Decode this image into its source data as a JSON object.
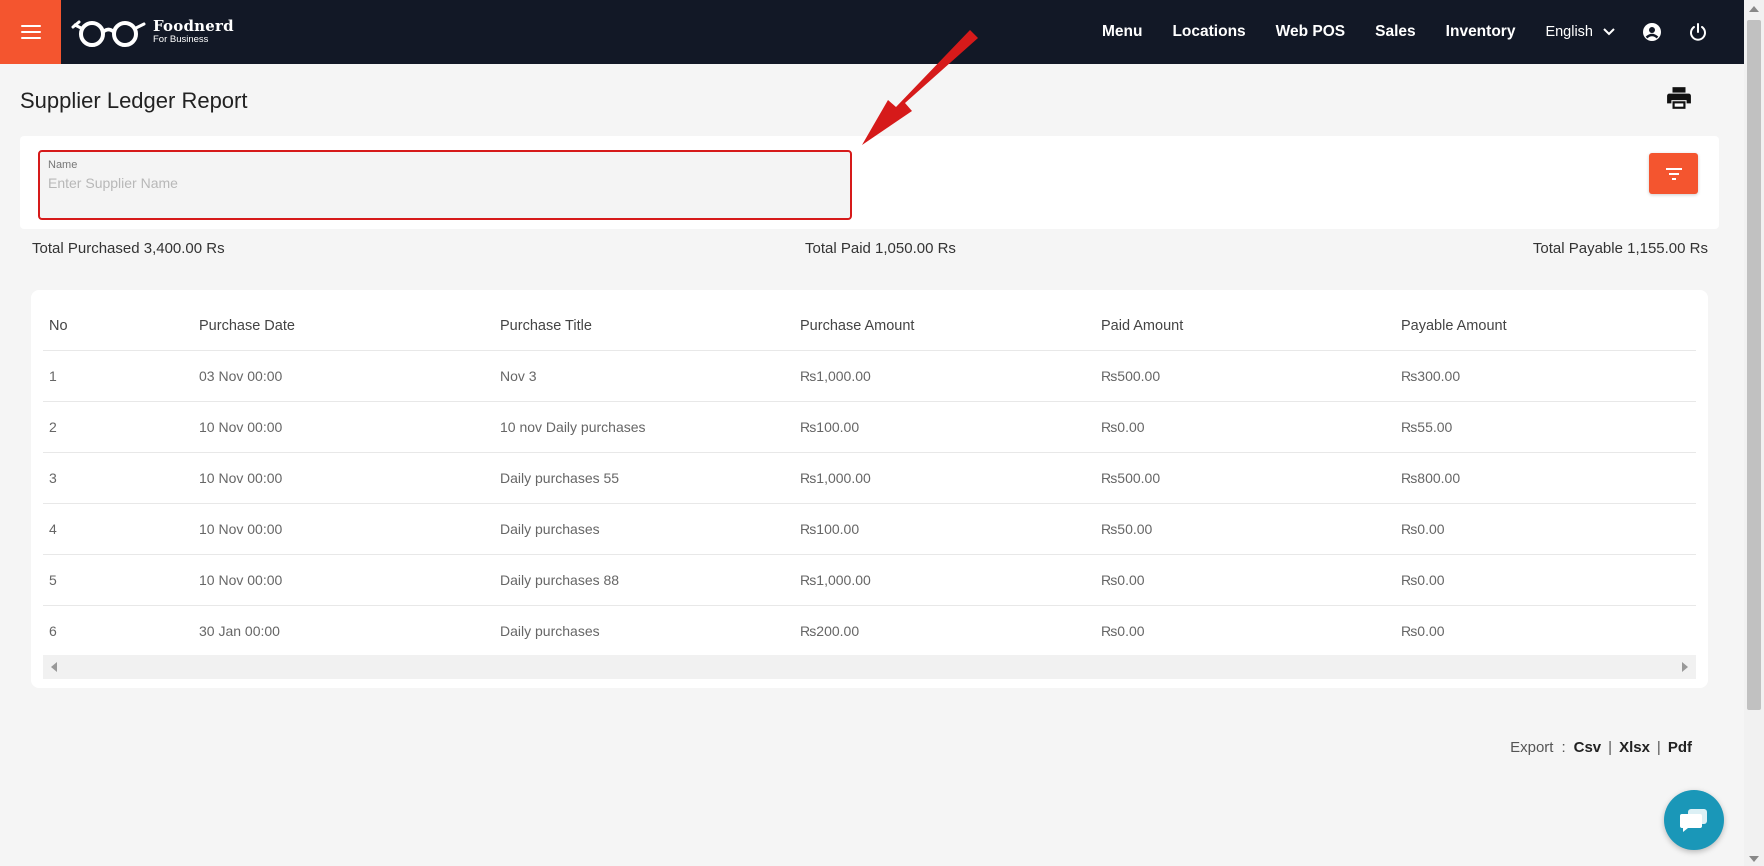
{
  "brand": {
    "name": "Foodnerd",
    "subtitle": "For Business"
  },
  "nav": {
    "items": [
      "Menu",
      "Locations",
      "Web POS",
      "Sales",
      "Inventory"
    ],
    "language": "English"
  },
  "page": {
    "title": "Supplier Ledger Report"
  },
  "filter": {
    "name_label": "Name",
    "name_placeholder": "Enter Supplier Name",
    "name_value": ""
  },
  "totals": {
    "purchased": "Total Purchased 3,400.00 Rs",
    "paid": "Total Paid 1,050.00 Rs",
    "payable": "Total Payable 1,155.00 Rs"
  },
  "table": {
    "headers": [
      "No",
      "Purchase Date",
      "Purchase Title",
      "Purchase Amount",
      "Paid Amount",
      "Payable Amount"
    ],
    "rows": [
      [
        "1",
        "03 Nov 00:00",
        "Nov 3",
        "₨1,000.00",
        "₨500.00",
        "₨300.00"
      ],
      [
        "2",
        "10 Nov 00:00",
        "10 nov Daily purchases",
        "₨100.00",
        "₨0.00",
        "₨55.00"
      ],
      [
        "3",
        "10 Nov 00:00",
        "Daily purchases 55",
        "₨1,000.00",
        "₨500.00",
        "₨800.00"
      ],
      [
        "4",
        "10 Nov 00:00",
        "Daily purchases",
        "₨100.00",
        "₨50.00",
        "₨0.00"
      ],
      [
        "5",
        "10 Nov 00:00",
        "Daily purchases 88",
        "₨1,000.00",
        "₨0.00",
        "₨0.00"
      ],
      [
        "6",
        "30 Jan 00:00",
        "Daily purchases",
        "₨200.00",
        "₨0.00",
        "₨0.00"
      ]
    ]
  },
  "export": {
    "label": "Export",
    "colon": ":",
    "options": [
      "Csv",
      "Xlsx",
      "Pdf"
    ],
    "separator": "|"
  },
  "icons": {
    "menu": "hamburger-icon",
    "logo": "glasses-logo",
    "chevron": "chevron-down-icon",
    "account": "account-circle-icon",
    "power": "power-icon",
    "print": "printer-icon",
    "filter": "filter-icon",
    "chat": "chat-icon"
  },
  "colors": {
    "accent": "#f4552f",
    "topbar": "#121826",
    "annotation": "#d61a1a",
    "chat": "#1a97b8"
  }
}
